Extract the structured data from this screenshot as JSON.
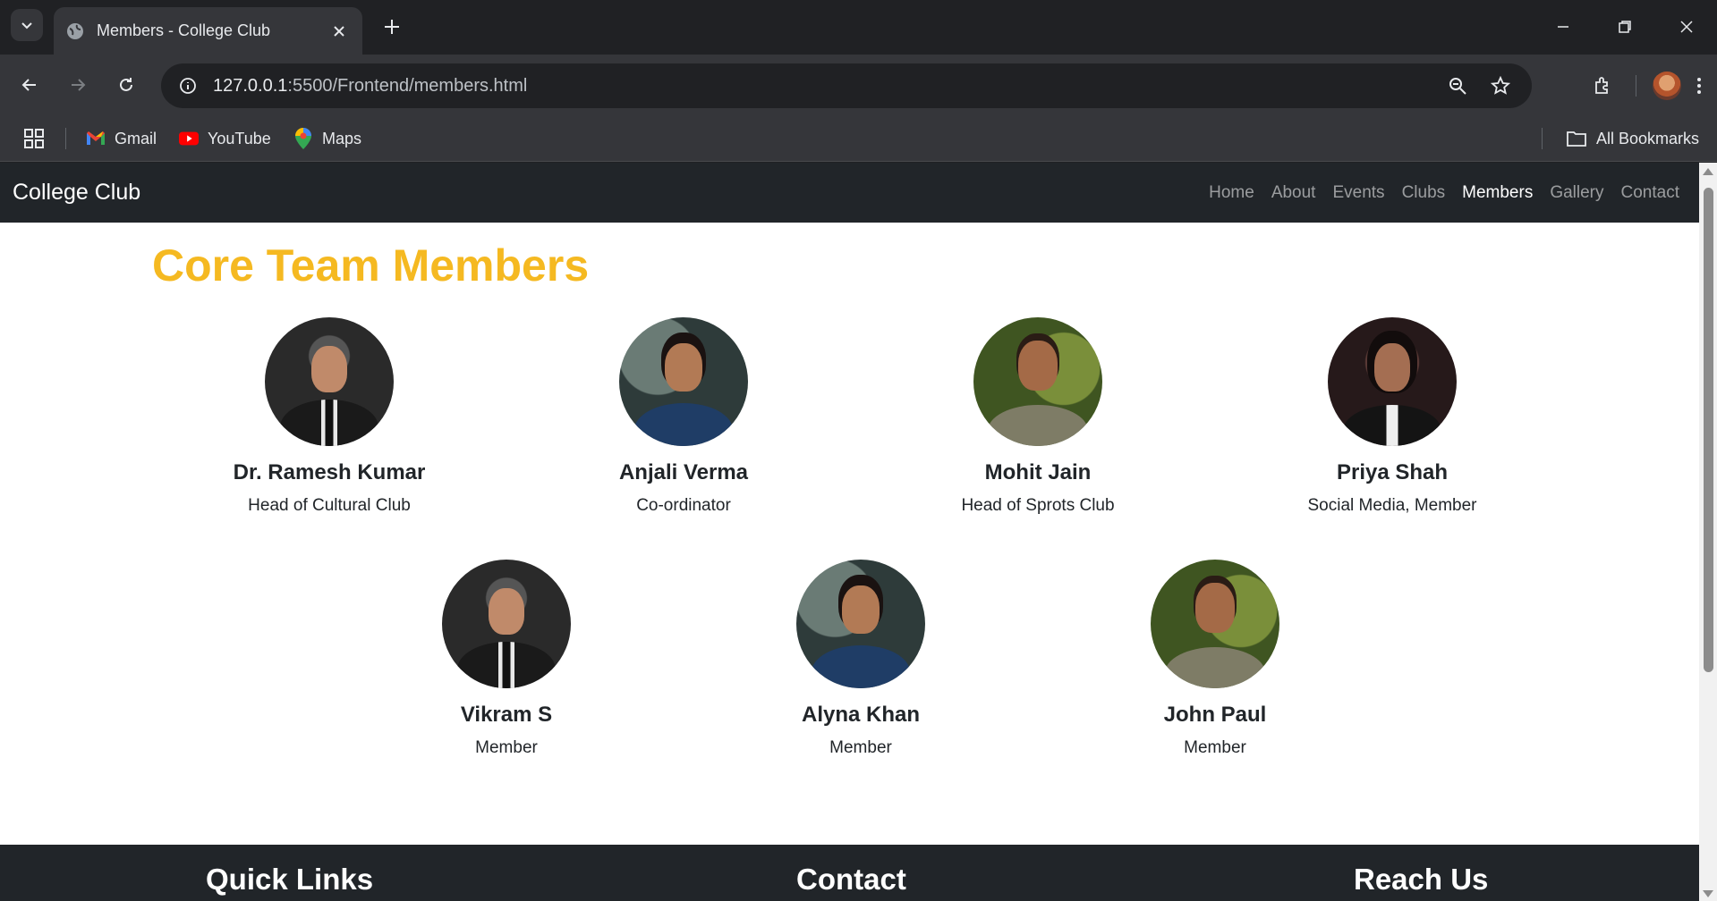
{
  "browser": {
    "tab_title": "Members - College Club",
    "url_host": "127.0.0.1",
    "url_path": ":5500/Frontend/members.html",
    "bookmarks": [
      {
        "label": "Gmail",
        "icon": "gmail-icon"
      },
      {
        "label": "YouTube",
        "icon": "youtube-icon"
      },
      {
        "label": "Maps",
        "icon": "maps-icon"
      }
    ],
    "all_bookmarks_label": "All Bookmarks"
  },
  "site": {
    "brand": "College Club",
    "nav": {
      "home": "Home",
      "about": "About",
      "events": "Events",
      "clubs": "Clubs",
      "members": "Members",
      "gallery": "Gallery",
      "contact": "Contact"
    },
    "active_nav": "Members",
    "section_title": "Core Team Members",
    "accent_color": "#f5b921",
    "members": [
      {
        "name": "Dr. Ramesh Kumar",
        "role": "Head of Cultural Club"
      },
      {
        "name": "Anjali Verma",
        "role": "Co-ordinator"
      },
      {
        "name": "Mohit Jain",
        "role": "Head of Sprots Club"
      },
      {
        "name": "Priya Shah",
        "role": "Social Media, Member"
      },
      {
        "name": "Vikram S",
        "role": "Member"
      },
      {
        "name": "Alyna Khan",
        "role": "Member"
      },
      {
        "name": "John Paul",
        "role": "Member"
      }
    ],
    "footer": {
      "quick_links": "Quick Links",
      "contact": "Contact",
      "reach_us": "Reach Us"
    }
  }
}
